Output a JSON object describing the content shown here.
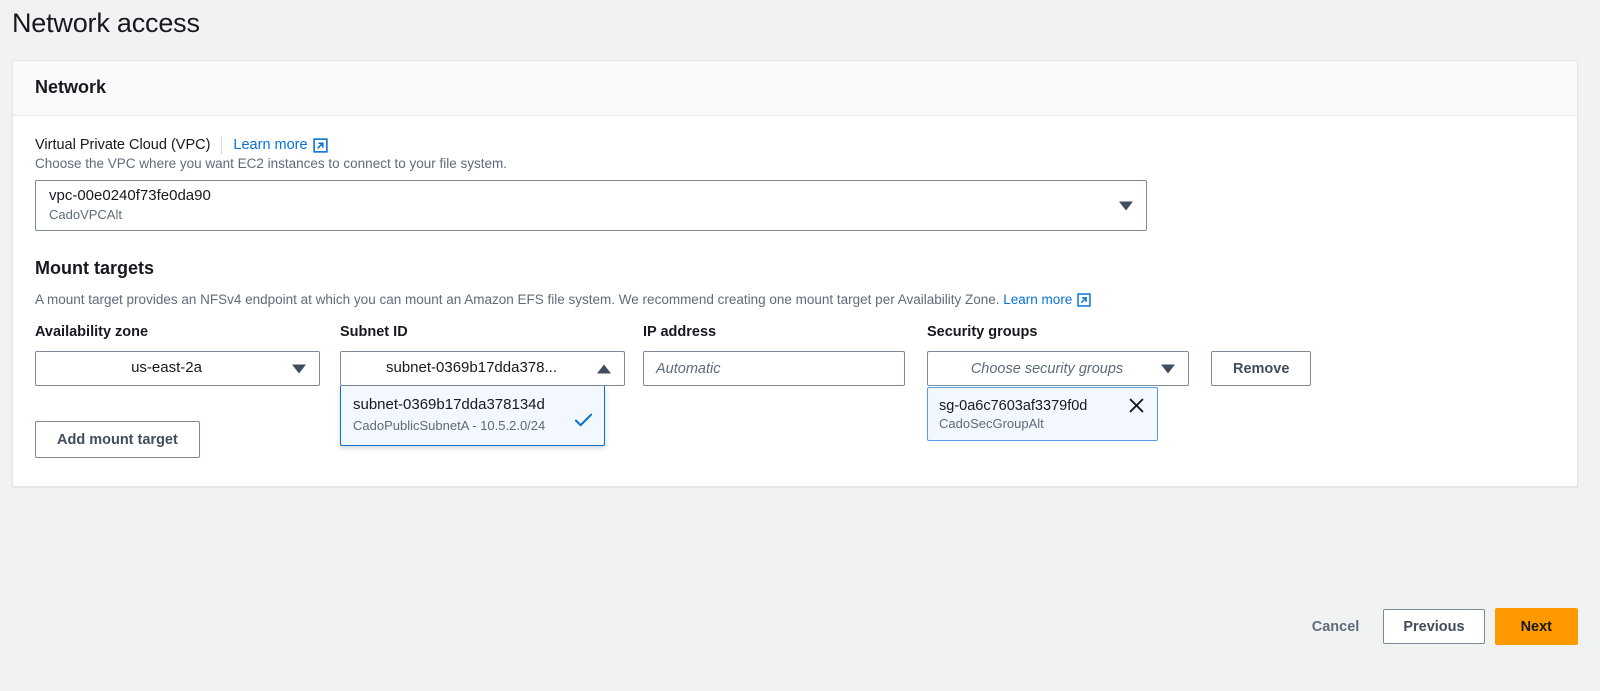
{
  "page": {
    "title": "Network access"
  },
  "card": {
    "header_title": "Network",
    "vpc": {
      "label": "Virtual Private Cloud (VPC)",
      "learn_more": "Learn more",
      "description": "Choose the VPC where you want EC2 instances to connect to your file system.",
      "selected_id": "vpc-00e0240f73fe0da90",
      "selected_name": "CadoVPCAlt"
    },
    "mount_targets": {
      "title": "Mount targets",
      "description": "A mount target provides an NFSv4 endpoint at which you can mount an Amazon EFS file system. We recommend creating one mount target per Availability Zone.",
      "learn_more": "Learn more",
      "columns": {
        "availability_zone": "Availability zone",
        "subnet_id": "Subnet ID",
        "ip_address": "IP address",
        "security_groups": "Security groups"
      },
      "rows": [
        {
          "availability_zone": "us-east-2a",
          "subnet_id_display": "subnet-0369b17dda378...",
          "subnet_dropdown_open": true,
          "subnet_options": [
            {
              "id": "subnet-0369b17dda378134d",
              "detail": "CadoPublicSubnetA - 10.5.2.0/24",
              "selected": true
            }
          ],
          "ip_address_value": "",
          "ip_address_placeholder": "Automatic",
          "security_groups_placeholder": "Choose security groups",
          "security_group_tokens": [
            {
              "id": "sg-0a6c7603af3379f0d",
              "name": "CadoSecGroupAlt"
            }
          ],
          "remove_label": "Remove"
        }
      ],
      "add_label": "Add mount target"
    }
  },
  "footer": {
    "cancel": "Cancel",
    "previous": "Previous",
    "next": "Next"
  },
  "colors": {
    "accent_orange": "#ff9900",
    "link_blue": "#0972d3",
    "page_bg": "#f1f3f3"
  }
}
